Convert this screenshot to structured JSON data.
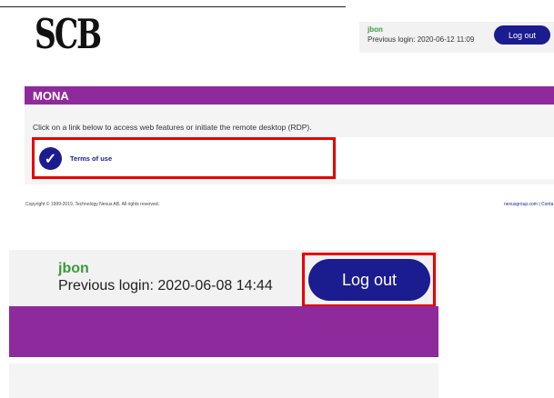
{
  "logo": {
    "text": "SCB"
  },
  "top_panel": {
    "username": "jbon",
    "previous_login": "Previous login: 2020-06-12 11:09",
    "logout_label": "Log out",
    "app_title": "MONA",
    "instructions": "Click on a link below to access web features or initiate the remote desktop (RDP).",
    "link_label": "Terms of use",
    "link_icon": "checkmark-icon",
    "copyright": "Copyright © 1999-2019, Technology Nexus AB. All rights reserved.",
    "footer_link": "nexusgroup.com | Conta"
  },
  "zoom_panel": {
    "username": "jbon",
    "previous_login": "Previous login: 2020-06-08 14:44",
    "logout_label": "Log out"
  },
  "colors": {
    "brand_purple": "#8e2a9c",
    "button_navy": "#1b1c8f",
    "username_green": "#3c9a3c",
    "highlight_red": "#e60000"
  }
}
